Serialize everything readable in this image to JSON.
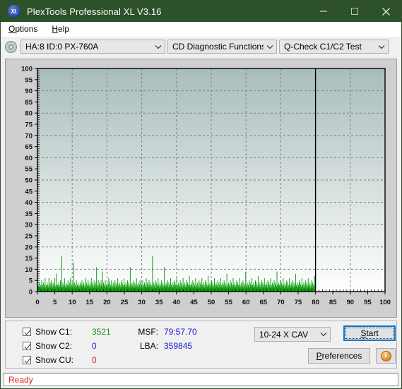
{
  "window": {
    "title": "PlexTools Professional XL V3.16",
    "icon_label": "XL",
    "minimize_label": "Minimize",
    "maximize_label": "Maximize",
    "close_label": "Close",
    "titlebar_color": "#2d5128"
  },
  "menubar": {
    "items": [
      {
        "label": "Options",
        "accel": "O"
      },
      {
        "label": "Help",
        "accel": "H"
      }
    ]
  },
  "toolbar": {
    "drive_select": {
      "value": "HA:8 ID:0  PX-760A"
    },
    "function_select": {
      "value": "CD Diagnostic Functions"
    },
    "test_select": {
      "value": "Q-Check C1/C2 Test"
    }
  },
  "stats": {
    "checkboxes": [
      {
        "name": "show-c1",
        "label": "Show C1:",
        "checked": true,
        "value": "3521",
        "color": "#1b8f1b"
      },
      {
        "name": "show-c2",
        "label": "Show C2:",
        "checked": true,
        "value": "0",
        "color": "#1a1ad0"
      },
      {
        "name": "show-cu",
        "label": "Show CU:",
        "checked": true,
        "value": "0",
        "color": "#d02020"
      }
    ],
    "msf_label": "MSF:",
    "msf_value": "79:57.70",
    "lba_label": "LBA:",
    "lba_value": "359845",
    "speed_select": {
      "value": "10-24 X CAV"
    },
    "start_button": {
      "label": "Start",
      "accel": "S"
    },
    "preferences_button": {
      "label": "Preferences",
      "accel": "P"
    },
    "info_button": {
      "label": "i"
    }
  },
  "statusbar": {
    "text": "Ready",
    "color": "#e02020"
  },
  "chart_data": {
    "type": "bar",
    "title": "",
    "xlabel": "",
    "ylabel": "",
    "xlim": [
      0,
      100
    ],
    "ylim": [
      0,
      100
    ],
    "xticks": [
      0,
      5,
      10,
      15,
      20,
      25,
      30,
      35,
      40,
      45,
      50,
      55,
      60,
      65,
      70,
      75,
      80,
      85,
      90,
      95,
      100
    ],
    "yticks": [
      0,
      5,
      10,
      15,
      20,
      25,
      30,
      35,
      40,
      45,
      50,
      55,
      60,
      65,
      70,
      75,
      80,
      85,
      90,
      95,
      100
    ],
    "grid": true,
    "legend": false,
    "series_color": "#11a011",
    "data_end_x": 80,
    "plot_bg_top": "#a8bdbb",
    "plot_bg_bottom": "#ffffff",
    "series": [
      {
        "name": "C1 errors",
        "color": "#11a011",
        "x_step": 0.2,
        "values": [
          2,
          1,
          3,
          2,
          1,
          4,
          2,
          1,
          2,
          3,
          1,
          2,
          5,
          2,
          1,
          3,
          2,
          4,
          1,
          2,
          3,
          1,
          6,
          2,
          1,
          3,
          2,
          1,
          4,
          2,
          3,
          1,
          2,
          6,
          3,
          2,
          1,
          4,
          2,
          1,
          5,
          2,
          3,
          1,
          2,
          4,
          1,
          3,
          2,
          1,
          6,
          2,
          1,
          3,
          2,
          8,
          2,
          1,
          3,
          2,
          1,
          4,
          2,
          3,
          1,
          2,
          5,
          2,
          1,
          3,
          16,
          2,
          1,
          4,
          2,
          3,
          1,
          2,
          6,
          2,
          1,
          3,
          2,
          4,
          1,
          2,
          3,
          1,
          5,
          2,
          3,
          1,
          2,
          4,
          1,
          6,
          2,
          1,
          3,
          2,
          4,
          2,
          1,
          3,
          13,
          2,
          1,
          4,
          2,
          3,
          1,
          2,
          5,
          2,
          1,
          3,
          2,
          4,
          1,
          2,
          3,
          1,
          2,
          4,
          2,
          1,
          3,
          2,
          5,
          1,
          2,
          3,
          1,
          4,
          2,
          1,
          3,
          2,
          6,
          1,
          2,
          4,
          1,
          3,
          2,
          1,
          5,
          2,
          3,
          1,
          2,
          4,
          1,
          2,
          3,
          6,
          2,
          1,
          4,
          2,
          3,
          1,
          2,
          5,
          1,
          3,
          2,
          1,
          4,
          2,
          11,
          2,
          1,
          3,
          2,
          5,
          1,
          2,
          4,
          1,
          3,
          2,
          1,
          5,
          2,
          3,
          1,
          9,
          2,
          1,
          4,
          2,
          3,
          1,
          2,
          5,
          1,
          2,
          3,
          1,
          4,
          2,
          1,
          3,
          2,
          6,
          1,
          2,
          4,
          1,
          3,
          2,
          1,
          5,
          2,
          3,
          1,
          2,
          4,
          1,
          2,
          3,
          1,
          5,
          2,
          1,
          4,
          2,
          3,
          1,
          2,
          6,
          1,
          3,
          2,
          1,
          4,
          2,
          3,
          1,
          2,
          5,
          1,
          2,
          4,
          1,
          3,
          2,
          1,
          6,
          2,
          3,
          1,
          2,
          4,
          1,
          2,
          3,
          1,
          5,
          2,
          1,
          4,
          2,
          3,
          1,
          2,
          11,
          1,
          3,
          2,
          1,
          4,
          2,
          3,
          1,
          2,
          5,
          1,
          2,
          4,
          1,
          3,
          2,
          1,
          6,
          2,
          3,
          1,
          2,
          4,
          1,
          2,
          3,
          1,
          5,
          2,
          1,
          4,
          2,
          3,
          1,
          2,
          5,
          1,
          3,
          2,
          1,
          4,
          2,
          3,
          1,
          2,
          6,
          1,
          2,
          4,
          1,
          3,
          2,
          1,
          5,
          2,
          3,
          1,
          2,
          4,
          1,
          2,
          3,
          1,
          16,
          2,
          1,
          4,
          2,
          3,
          1,
          2,
          5,
          1,
          2,
          4,
          1,
          3,
          2,
          1,
          6,
          2,
          3,
          1,
          2,
          4,
          1,
          2,
          3,
          1,
          5,
          2,
          1,
          4,
          2,
          3,
          1,
          2,
          11,
          1,
          3,
          2,
          1,
          4,
          2,
          3,
          1,
          2,
          5,
          1,
          2,
          4,
          1,
          3,
          2,
          1,
          6,
          2,
          3,
          1,
          2,
          4,
          1,
          2,
          3,
          1,
          5,
          2,
          1,
          4,
          2,
          3,
          1,
          2,
          6,
          1,
          3,
          2,
          1,
          4,
          2,
          3,
          1,
          2,
          5,
          1,
          2,
          4,
          1,
          3,
          2,
          1,
          6,
          2,
          3,
          1,
          2,
          4,
          1,
          2,
          3,
          1,
          5,
          2,
          1,
          4,
          2,
          3,
          1,
          2,
          7,
          1,
          3,
          2,
          1,
          4,
          2,
          3,
          1,
          2,
          5,
          1,
          2,
          4,
          1,
          3,
          2,
          1,
          6,
          2,
          3,
          1,
          2,
          4,
          1,
          2,
          3,
          1,
          5,
          2,
          1,
          4,
          2,
          3,
          1,
          2,
          6,
          1,
          3,
          2,
          1,
          4,
          2,
          3,
          1,
          2,
          5,
          1,
          2,
          4,
          1,
          3,
          2,
          1,
          7,
          2,
          3,
          1,
          2,
          4,
          1,
          2,
          3,
          1,
          5,
          2,
          1,
          4,
          2,
          3,
          1,
          2,
          6,
          1,
          3,
          2,
          1,
          4,
          2,
          3,
          1,
          2,
          5,
          1,
          2,
          4,
          1,
          3,
          2,
          1,
          6,
          2,
          3,
          1,
          2,
          4,
          1,
          2,
          3,
          1,
          5,
          2,
          1,
          4,
          2,
          3,
          1,
          2,
          8,
          1,
          3,
          2,
          1,
          4,
          2,
          3,
          1,
          2,
          5,
          1,
          2,
          4,
          1,
          3,
          2,
          1,
          6,
          2,
          3,
          1,
          2,
          4,
          1,
          2,
          3,
          1,
          5,
          2,
          1,
          4,
          2,
          3,
          1,
          2,
          6,
          1,
          3,
          2,
          1,
          4,
          2,
          3,
          1,
          2,
          5,
          1,
          2,
          4,
          1,
          3,
          2,
          1,
          9,
          2,
          3,
          1,
          2,
          4,
          1,
          2,
          3,
          1,
          5,
          2,
          1,
          4,
          2,
          3,
          1,
          2,
          6,
          1,
          3,
          2,
          1,
          4,
          2,
          3,
          1,
          2,
          5,
          1,
          2,
          4,
          1,
          3,
          2,
          1,
          7,
          2,
          3,
          1,
          2,
          4,
          1,
          2,
          3,
          1,
          5,
          2,
          1,
          4,
          2,
          3,
          1,
          2,
          6,
          1,
          3,
          2,
          1,
          4,
          2,
          3,
          1,
          2,
          5,
          1,
          2,
          4,
          1,
          3,
          2,
          1,
          6,
          2,
          3,
          1,
          2,
          4,
          1,
          2,
          3,
          1,
          5,
          2,
          1,
          4,
          2,
          3,
          1,
          2,
          9,
          1,
          3,
          2,
          1,
          4,
          2,
          3,
          1,
          2,
          5,
          1,
          2,
          4,
          1,
          3,
          2,
          1,
          6,
          2,
          3,
          1,
          2,
          4,
          1,
          2,
          3,
          1,
          5,
          2,
          1,
          4,
          2,
          3,
          1,
          2,
          6,
          1,
          3,
          2,
          1,
          4,
          2,
          3,
          1,
          2,
          5,
          1,
          2,
          4,
          1,
          3,
          2,
          1,
          8,
          2,
          3,
          1,
          2,
          4,
          1,
          2,
          3,
          1,
          5,
          2,
          1,
          4,
          2,
          3,
          1,
          2,
          6,
          1,
          3,
          2,
          1,
          4,
          2,
          3,
          1,
          2,
          5,
          1,
          2,
          4,
          1,
          3,
          2,
          1,
          6,
          2,
          3,
          1,
          2,
          4,
          1,
          2,
          3,
          1,
          5,
          2,
          1,
          4,
          2,
          3,
          1,
          2,
          7,
          1,
          3
        ]
      }
    ]
  }
}
